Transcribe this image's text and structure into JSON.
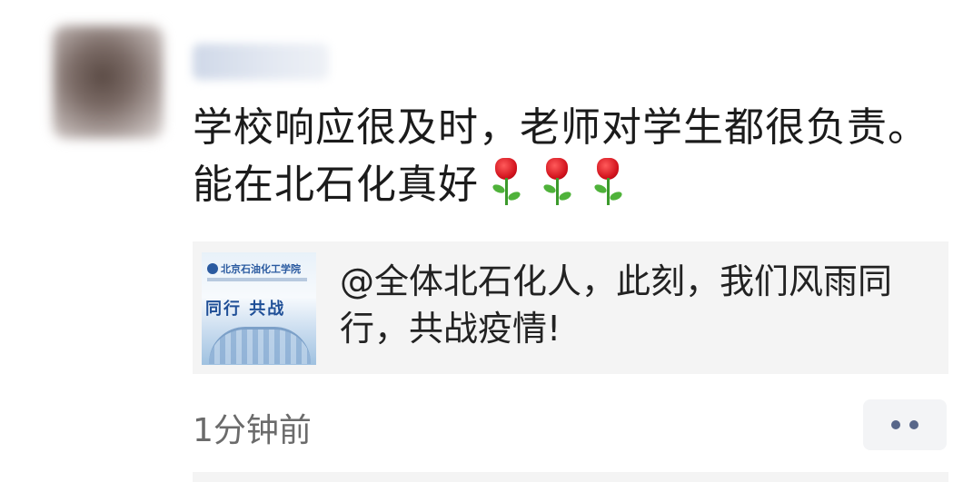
{
  "post": {
    "text": "学校响应很及时，老师对学生都很负责。能在北石化真好",
    "emoji": [
      "rose-emoji",
      "rose-emoji",
      "rose-emoji"
    ]
  },
  "shared_link": {
    "title": "@全体北石化人，此刻，我们风雨同行，共战疫情!",
    "thumbnail": {
      "school_name": "北京石油化工学院",
      "slogan": "同行 共战"
    }
  },
  "footer": {
    "time": "1分钟前",
    "more_icon": "more-dots-icon"
  },
  "colors": {
    "accent": "#58678a",
    "card_bg": "#f4f4f4",
    "time_text": "#6b6b6b"
  }
}
